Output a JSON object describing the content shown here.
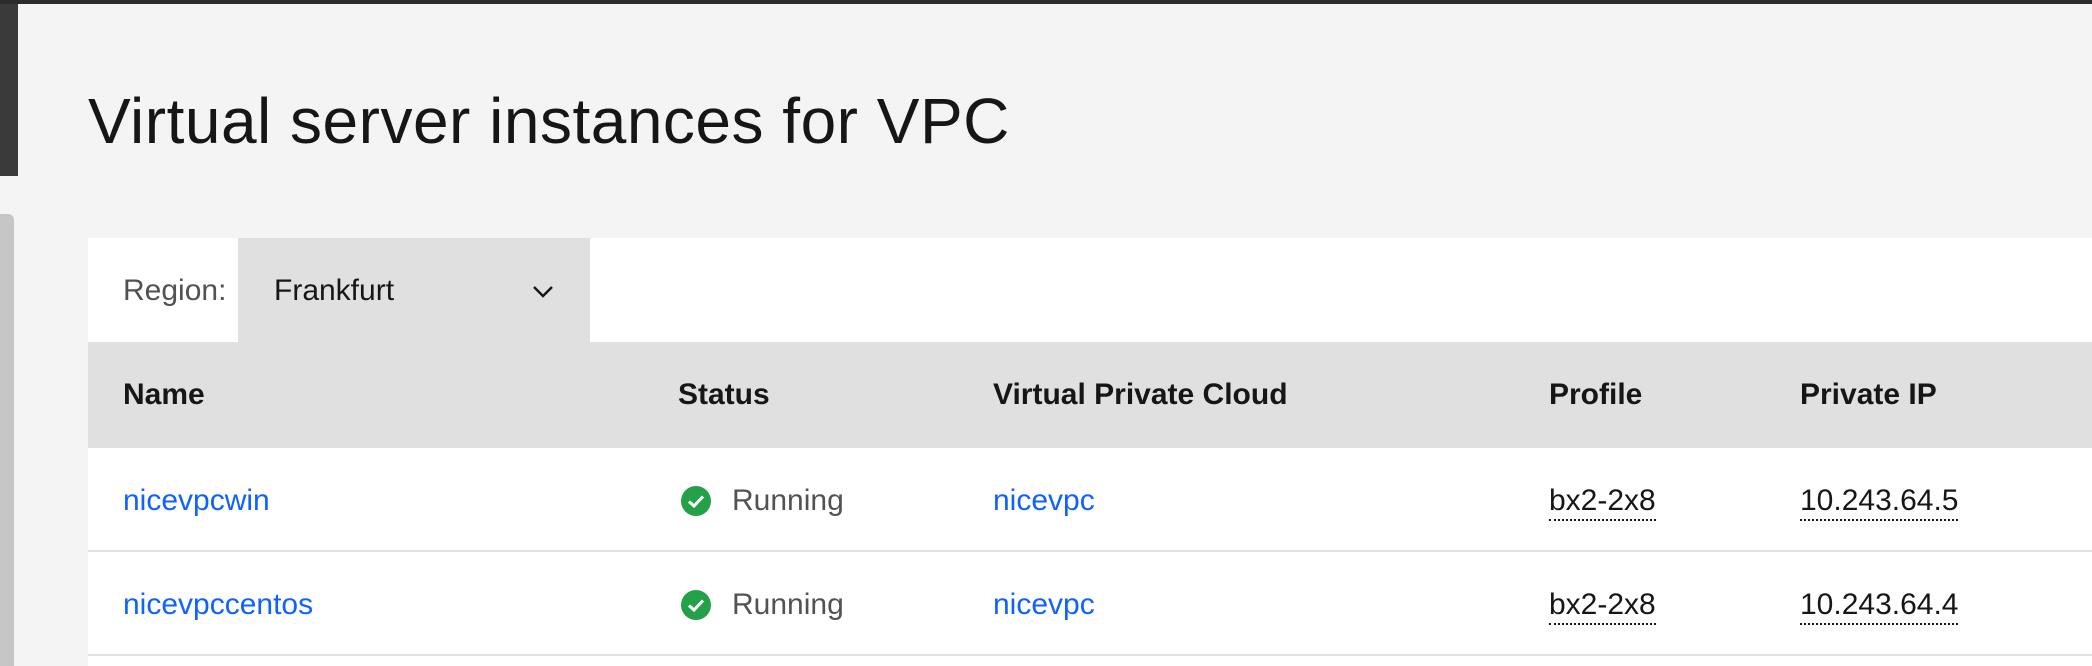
{
  "page": {
    "title": "Virtual server instances for VPC"
  },
  "filter": {
    "region_label": "Region:",
    "region_value": "Frankfurt"
  },
  "table": {
    "headers": {
      "name": "Name",
      "status": "Status",
      "vpc": "Virtual Private Cloud",
      "profile": "Profile",
      "private_ip": "Private IP"
    },
    "rows": [
      {
        "name": "nicevpcwin",
        "status": "Running",
        "vpc": "nicevpc",
        "profile": "bx2-2x8",
        "private_ip": "10.243.64.5"
      },
      {
        "name": "nicevpccentos",
        "status": "Running",
        "vpc": "nicevpc",
        "profile": "bx2-2x8",
        "private_ip": "10.243.64.4"
      }
    ]
  },
  "icons": {
    "status": "checkmark-filled-icon",
    "dropdown": "chevron-down-icon"
  },
  "colors": {
    "link": "#0f62fe",
    "status_ok": "#24a148",
    "header_bg": "#e0e0e0",
    "page_bg": "#f4f4f4"
  }
}
